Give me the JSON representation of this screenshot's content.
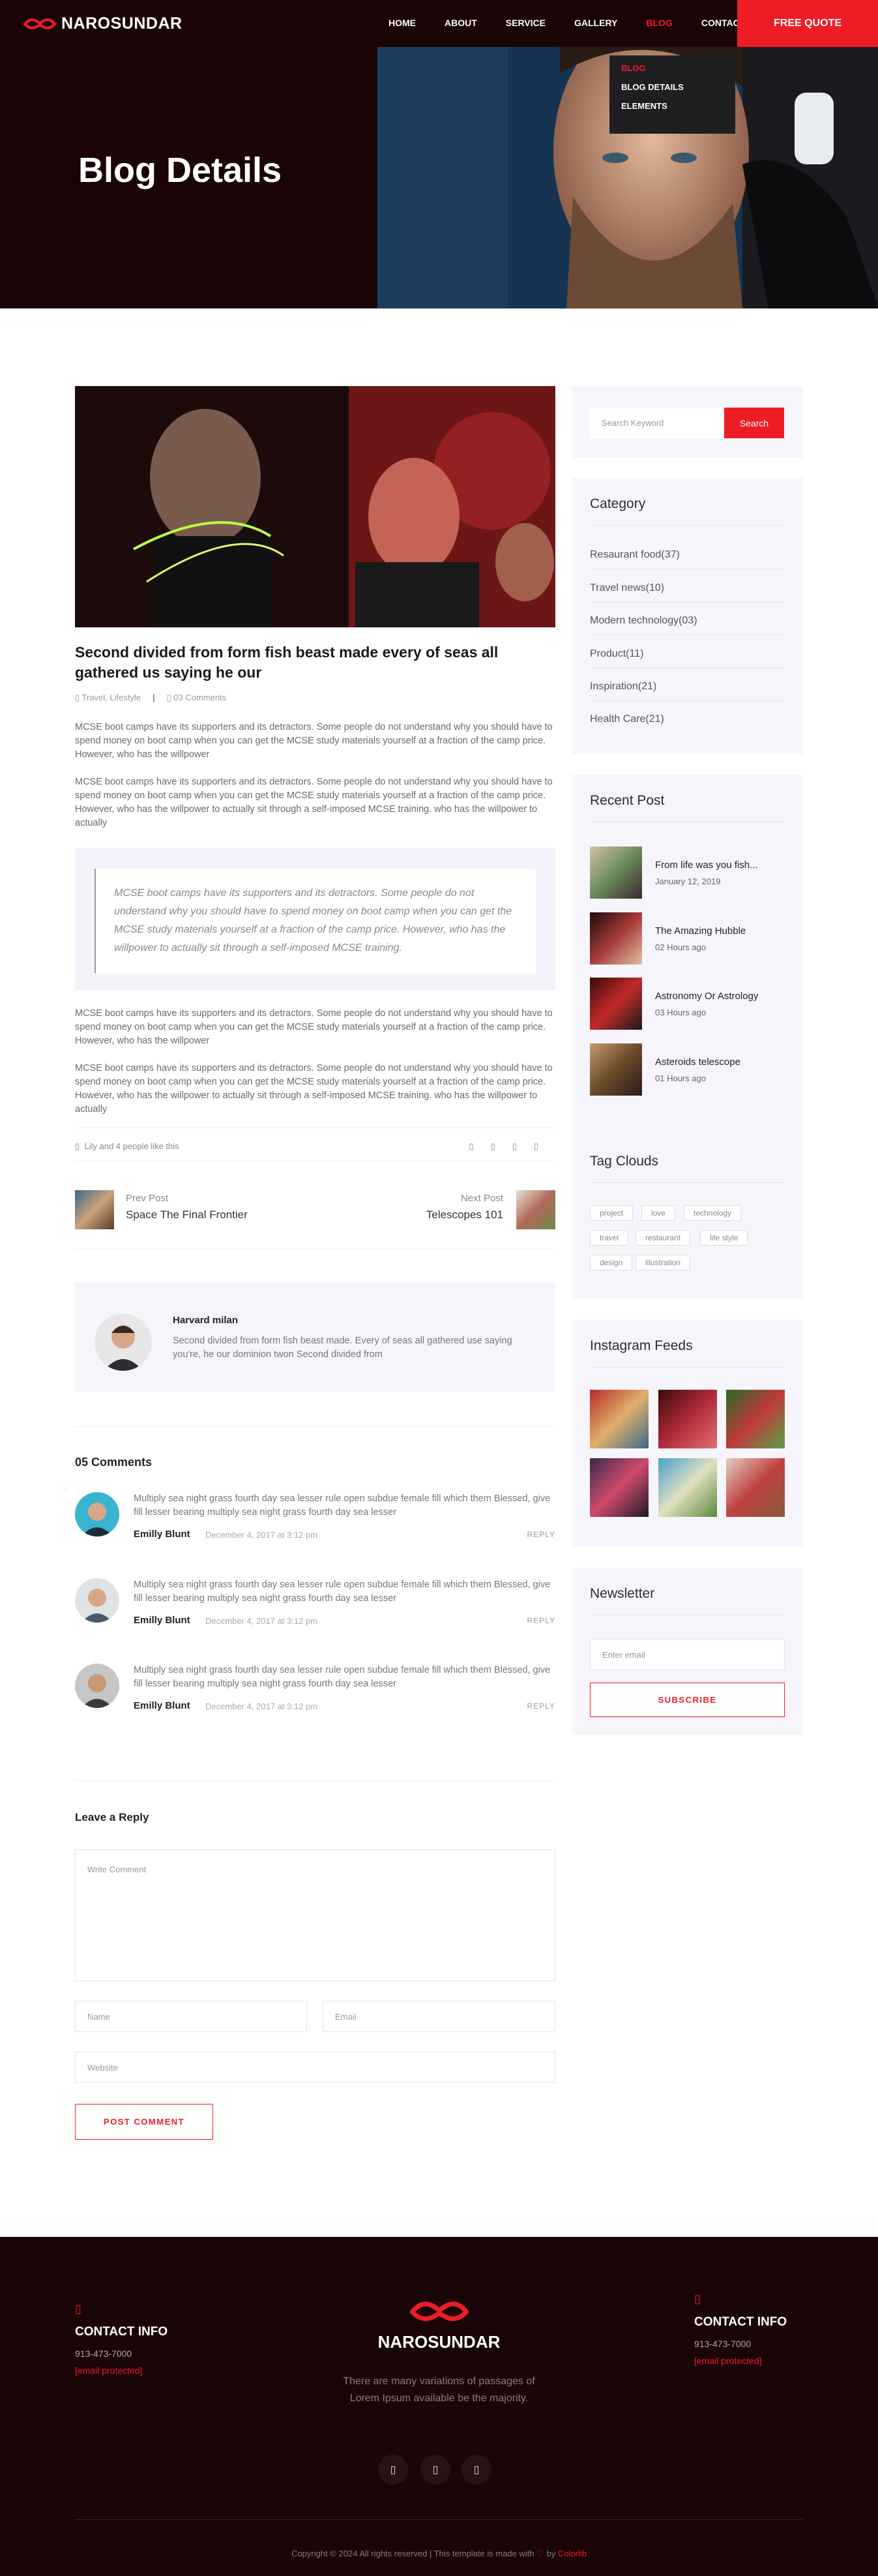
{
  "header": {
    "logo": "NAROSUNDAR",
    "nav": [
      "HOME",
      "ABOUT",
      "SERVICE",
      "GALLERY",
      "BLOG",
      "CONTACT"
    ],
    "quote": "FREE QUOTE",
    "dropdown": [
      "BLOG",
      "BLOG DETAILS",
      "ELEMENTS"
    ]
  },
  "hero": {
    "title": "Blog Details"
  },
  "post": {
    "title": "Second divided from form fish beast made every of seas all gathered us saying he our",
    "category": "Travel, Lifestyle",
    "comments": "03 Comments",
    "p1": "MCSE boot camps have its supporters and its detractors. Some people do not understand why you should have to spend money on boot camp when you can get the MCSE study materials yourself at a fraction of the camp price. However, who has the willpower",
    "p2": "MCSE boot camps have its supporters and its detractors. Some people do not understand why you should have to spend money on boot camp when you can get the MCSE study materials yourself at a fraction of the camp price. However, who has the willpower to actually sit through a self-imposed MCSE training. who has the willpower to actually",
    "quote": "MCSE boot camps have its supporters and its detractors. Some people do not understand why you should have to spend money on boot camp when you can get the MCSE study materials yourself at a fraction of the camp price. However, who has the willpower to actually sit through a self-imposed MCSE training.",
    "p3": "MCSE boot camps have its supporters and its detractors. Some people do not understand why you should have to spend money on boot camp when you can get the MCSE study materials yourself at a fraction of the camp price. However, who has the willpower",
    "p4": "MCSE boot camps have its supporters and its detractors. Some people do not understand why you should have to spend money on boot camp when you can get the MCSE study materials yourself at a fraction of the camp price. However, who has the willpower to actually sit through a self-imposed MCSE training. who has the willpower to actually",
    "likes": "Lily and 4 people like this"
  },
  "postnav": {
    "prev_label": "Prev Post",
    "prev_title": "Space The Final Frontier",
    "next_label": "Next Post",
    "next_title": "Telescopes 101"
  },
  "author": {
    "name": "Harvard milan",
    "bio": "Second divided from form fish beast made. Every of seas all gathered use saying you're, he our dominion twon Second divided from"
  },
  "comments": {
    "heading": "05 Comments",
    "items": [
      {
        "text": "Multiply sea night grass fourth day sea lesser rule open subdue female fill which them Blessed, give fill lesser bearing multiply sea night grass fourth day sea lesser",
        "name": "Emilly Blunt",
        "date": "December 4, 2017 at 3:12 pm",
        "reply": "REPLY"
      },
      {
        "text": "Multiply sea night grass fourth day sea lesser rule open subdue female fill which them Blessed, give fill lesser bearing multiply sea night grass fourth day sea lesser",
        "name": "Emilly Blunt",
        "date": "December 4, 2017 at 3:12 pm",
        "reply": "REPLY"
      },
      {
        "text": "Multiply sea night grass fourth day sea lesser rule open subdue female fill which them Blessed, give fill lesser bearing multiply sea night grass fourth day sea lesser",
        "name": "Emilly Blunt",
        "date": "December 4, 2017 at 3:12 pm",
        "reply": "REPLY"
      }
    ]
  },
  "reply": {
    "heading": "Leave a Reply",
    "comment_ph": "Write Comment",
    "name_ph": "Name",
    "email_ph": "Email",
    "website_ph": "Website",
    "button": "POST COMMENT"
  },
  "sidebar": {
    "search_ph": "Search Keyword",
    "search_btn": "Search",
    "category_title": "Category",
    "categories": [
      "Resaurant food(37)",
      "Travel news(10)",
      "Modern technology(03)",
      "Product(11)",
      "Inspiration(21)",
      "Health Care(21)"
    ],
    "recent_title": "Recent Post",
    "recent": [
      {
        "title": "From life was you fish...",
        "date": "January 12, 2019"
      },
      {
        "title": "The Amazing Hubble",
        "date": "02 Hours ago"
      },
      {
        "title": "Astronomy Or Astrology",
        "date": "03 Hours ago"
      },
      {
        "title": "Asteroids telescope",
        "date": "01 Hours ago"
      }
    ],
    "tags_title": "Tag Clouds",
    "tags": [
      "project",
      "love",
      "technology",
      "travel",
      "restaurant",
      "life style",
      "design",
      "illustration"
    ],
    "insta_title": "Instagram Feeds",
    "news_title": "Newsletter",
    "news_ph": "Enter email",
    "news_btn": "SUBSCRIBE"
  },
  "footer": {
    "contact_title": "CONTACT INFO",
    "phone": "913-473-7000",
    "email": "[email protected]",
    "brand": "NAROSUNDAR",
    "desc": "There are many variations of passages of Lorem Ipsum available be the majority.",
    "contact_title2": "CONTACT INFO",
    "phone2": "913-473-7000",
    "email2": "[email protected]",
    "copy_a": "Copyright © 2024 All rights reserved | This template is made with ",
    "heart": "♡",
    "copy_b": " by ",
    "colorlib": "Colorlib"
  }
}
